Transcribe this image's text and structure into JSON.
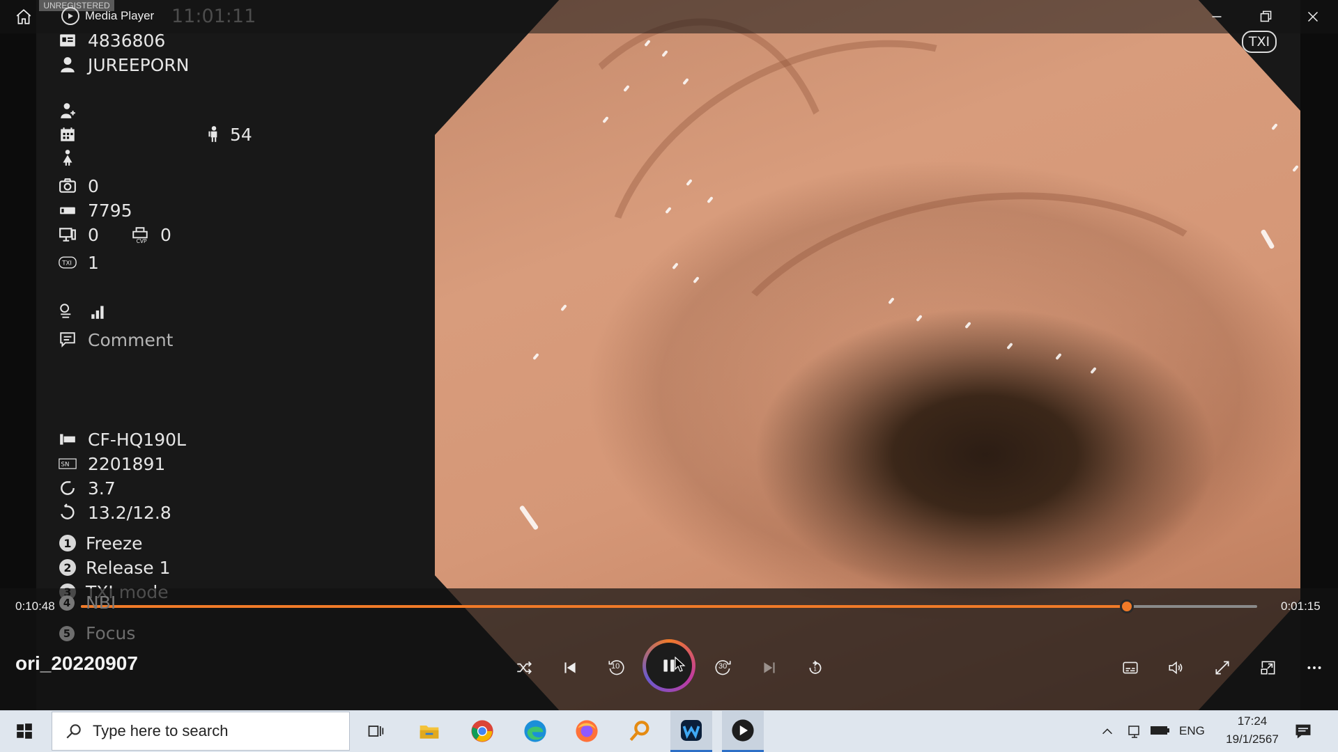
{
  "window": {
    "app_title": "Media Player",
    "watermark": "UNREGISTERED",
    "overlay_time": "11:01:11"
  },
  "overlay": {
    "patient_id": "4836806",
    "patient_name": "JUREEPORN",
    "age": "54",
    "capture_count": "0",
    "counter": "7795",
    "monitor_count": "0",
    "cvp_count": "0",
    "txi_level": "1",
    "comment": "Comment",
    "scope_model": "CF-HQ190L",
    "serial_number": "2201891",
    "value_a": "3.7",
    "value_b": "13.2/12.8",
    "buttons": [
      {
        "num": "1",
        "label": "Freeze"
      },
      {
        "num": "2",
        "label": "Release 1"
      },
      {
        "num": "3",
        "label": "TXI mode"
      },
      {
        "num": "4",
        "label": "NBI"
      },
      {
        "num": "5",
        "label": "Focus"
      }
    ],
    "txi_badge": "TXI"
  },
  "player": {
    "elapsed": "0:10:48",
    "remaining": "0:01:15",
    "progress": 0.889,
    "file_name": "ori_20220907",
    "skip_back_label": "10",
    "skip_forward_label": "30"
  },
  "taskbar": {
    "search_placeholder": "Type here to search",
    "language": "ENG",
    "time": "17:24",
    "date": "19/1/2567"
  },
  "colors": {
    "accent": "#f07a28",
    "taskbar": "#dfe6ee"
  }
}
